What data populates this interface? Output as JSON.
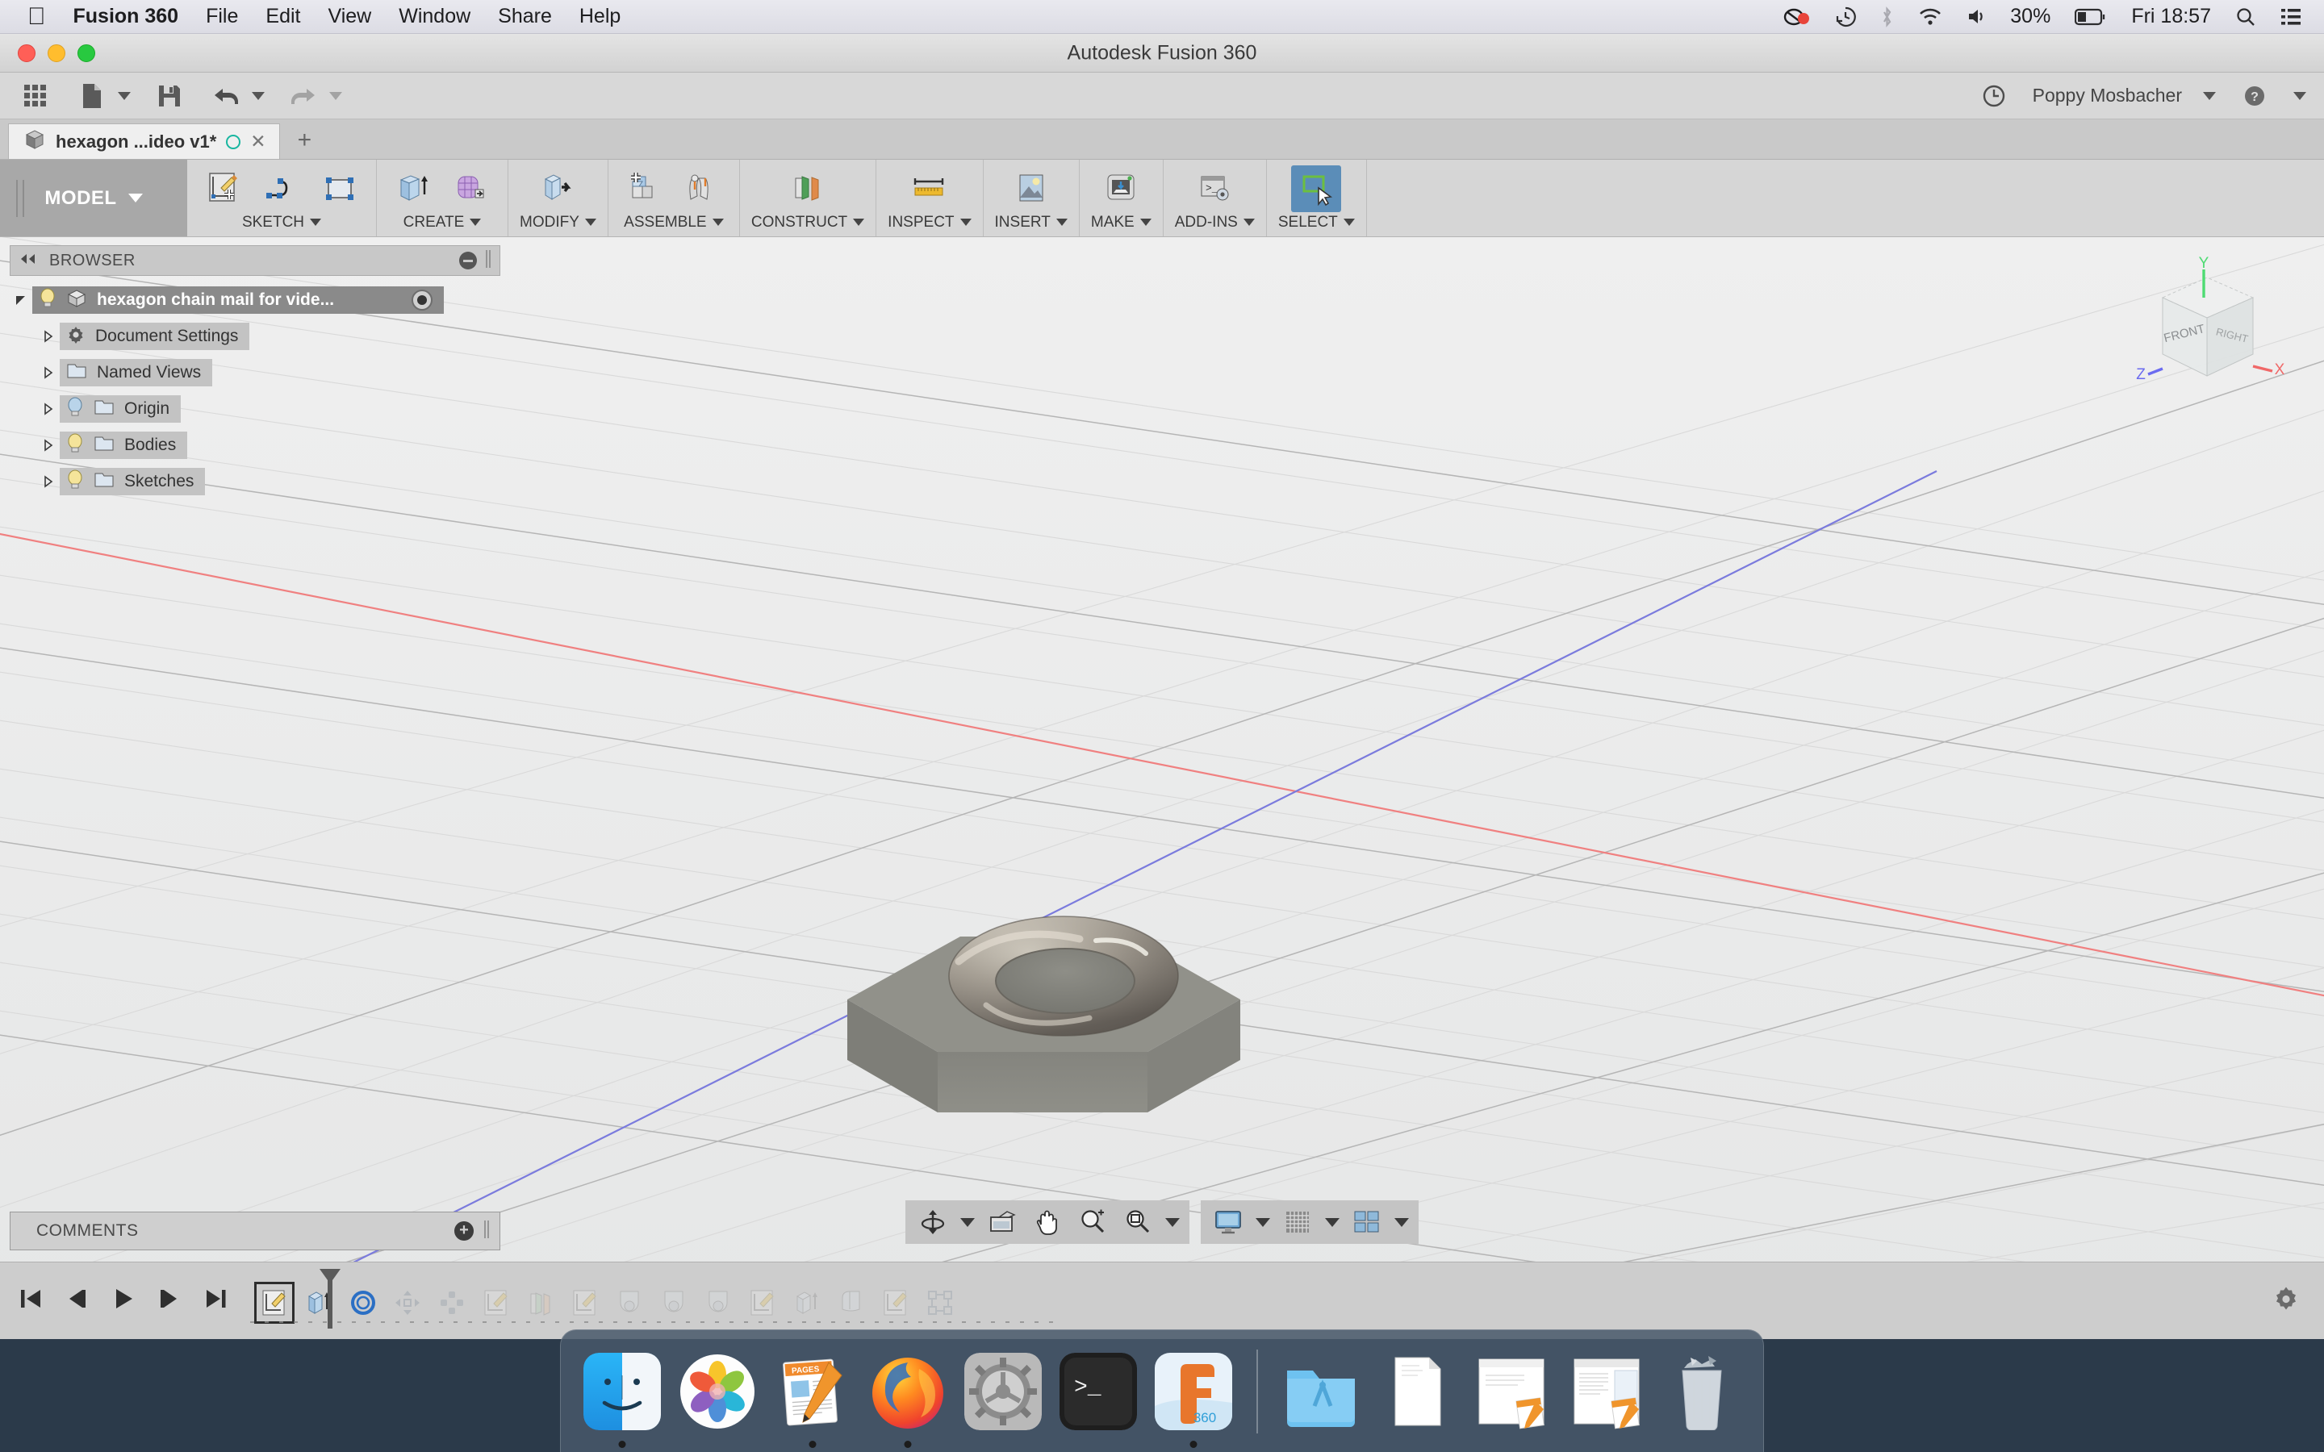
{
  "menubar": {
    "apple": "apple-logo",
    "items": [
      {
        "label": "Fusion 360",
        "bold": true
      },
      {
        "label": "File"
      },
      {
        "label": "Edit"
      },
      {
        "label": "View"
      },
      {
        "label": "Window"
      },
      {
        "label": "Share"
      },
      {
        "label": "Help"
      }
    ],
    "status": {
      "battery_percent": "30%",
      "clock": "Fri 18:57",
      "icons": [
        "screen-recording-icon",
        "time-machine-icon",
        "bluetooth-icon",
        "wifi-icon",
        "volume-icon",
        "battery-icon",
        "search-icon",
        "control-center-icon"
      ]
    }
  },
  "window": {
    "title": "Autodesk Fusion 360"
  },
  "quick_access": {
    "buttons": [
      "grid-apps-icon",
      "new-document-icon",
      "save-icon",
      "undo-icon",
      "redo-icon"
    ],
    "history_icon": "clock-history-icon",
    "user_name": "Poppy Mosbacher",
    "help_icon": "help-icon"
  },
  "tabs": {
    "document": {
      "label": "hexagon ...ideo v1*",
      "icon": "cube-icon",
      "status_dot": "sync-circle-icon",
      "close": "close-icon"
    },
    "new_tab": "+"
  },
  "ribbon": {
    "workspace": {
      "label": "MODEL",
      "has_caret": true
    },
    "groups": [
      {
        "label": "SKETCH",
        "tools": [
          "create-sketch-icon",
          "spline-icon",
          "rectangle-icon"
        ],
        "active": false
      },
      {
        "label": "CREATE",
        "tools": [
          "extrude-icon",
          "pattern-icon"
        ],
        "active": false
      },
      {
        "label": "MODIFY",
        "tools": [
          "press-pull-icon"
        ],
        "active": false
      },
      {
        "label": "ASSEMBLE",
        "tools": [
          "new-component-icon",
          "joint-icon"
        ],
        "active": false
      },
      {
        "label": "CONSTRUCT",
        "tools": [
          "offset-plane-icon"
        ],
        "active": false
      },
      {
        "label": "INSPECT",
        "tools": [
          "measure-icon"
        ],
        "active": false
      },
      {
        "label": "INSERT",
        "tools": [
          "insert-image-icon"
        ],
        "active": false
      },
      {
        "label": "MAKE",
        "tools": [
          "3d-print-icon"
        ],
        "active": false
      },
      {
        "label": "ADD-INS",
        "tools": [
          "scripts-addins-icon"
        ],
        "active": false
      },
      {
        "label": "SELECT",
        "tools": [
          "select-cursor-icon"
        ],
        "active": true
      }
    ]
  },
  "browser": {
    "title": "BROWSER",
    "collapse_icon": "collapse-left-icon",
    "minimize_icon": "minimize-icon",
    "root": {
      "label": "hexagon chain mail for vide...",
      "bulb": "on",
      "icon": "component-cube-icon",
      "radio": "active-component-radio"
    },
    "items": [
      {
        "label": "Document Settings",
        "icon": "gear-icon",
        "bulb": "none"
      },
      {
        "label": "Named Views",
        "icon": "folder-icon",
        "bulb": "none"
      },
      {
        "label": "Origin",
        "icon": "folder-icon",
        "bulb": "off"
      },
      {
        "label": "Bodies",
        "icon": "folder-icon",
        "bulb": "on"
      },
      {
        "label": "Sketches",
        "icon": "folder-icon",
        "bulb": "on"
      }
    ]
  },
  "comments": {
    "title": "COMMENTS",
    "add_icon": "add-comment-icon"
  },
  "viewcube": {
    "front_face": "FRONT",
    "right_face": "RIGHT",
    "axes": [
      {
        "label": "Y",
        "color": "#4ddb72"
      },
      {
        "label": "X",
        "color": "#f06868"
      },
      {
        "label": "Z",
        "color": "#6b6bf0"
      }
    ]
  },
  "navbar": {
    "group1": [
      "orbit-icon",
      "look-at-icon",
      "pan-icon",
      "zoom-icon",
      "zoom-window-icon"
    ],
    "group2": [
      "display-settings-icon",
      "grid-snaps-icon",
      "viewports-icon"
    ]
  },
  "timeline": {
    "playback": [
      "go-to-start-icon",
      "step-back-icon",
      "play-icon",
      "step-forward-icon",
      "go-to-end-icon"
    ],
    "features": [
      {
        "icon": "sketch-icon",
        "state": "selected"
      },
      {
        "icon": "extrude-icon",
        "state": "normal"
      },
      {
        "icon": "torus-icon",
        "state": "normal"
      },
      {
        "icon": "move-icon",
        "state": "dim"
      },
      {
        "icon": "pattern-icon",
        "state": "dim"
      },
      {
        "icon": "sketch-icon",
        "state": "dim"
      },
      {
        "icon": "plane-icon",
        "state": "dim"
      },
      {
        "icon": "sketch-icon",
        "state": "dim"
      },
      {
        "icon": "revolve-icon",
        "state": "dim"
      },
      {
        "icon": "revolve-icon",
        "state": "dim"
      },
      {
        "icon": "revolve-icon",
        "state": "dim"
      },
      {
        "icon": "sketch-icon",
        "state": "dim"
      },
      {
        "icon": "extrude-icon",
        "state": "dim"
      },
      {
        "icon": "fillet-icon",
        "state": "dim"
      },
      {
        "icon": "sketch-icon",
        "state": "dim"
      },
      {
        "icon": "pattern-grid-icon",
        "state": "dim"
      }
    ],
    "settings_icon": "gear-icon"
  },
  "canvas": {
    "model": {
      "name": "hexagon-with-torus-ring",
      "body_color": "#8b8b85",
      "ring_color": "#a39d92"
    },
    "axes": {
      "x_color": "#f08080",
      "z_color": "#7b7bdd"
    },
    "background": "#eceded"
  },
  "dock": {
    "items": [
      {
        "name": "finder",
        "running": true
      },
      {
        "name": "photos",
        "running": false
      },
      {
        "name": "pages",
        "running": true
      },
      {
        "name": "firefox",
        "running": true
      },
      {
        "name": "system-preferences",
        "running": false
      },
      {
        "name": "terminal",
        "running": false
      },
      {
        "name": "fusion-360",
        "label": "360",
        "running": true
      }
    ],
    "right_items": [
      {
        "name": "applications-folder"
      },
      {
        "name": "documents-stack"
      },
      {
        "name": "pages-document-1"
      },
      {
        "name": "pages-document-2"
      },
      {
        "name": "trash"
      }
    ]
  }
}
